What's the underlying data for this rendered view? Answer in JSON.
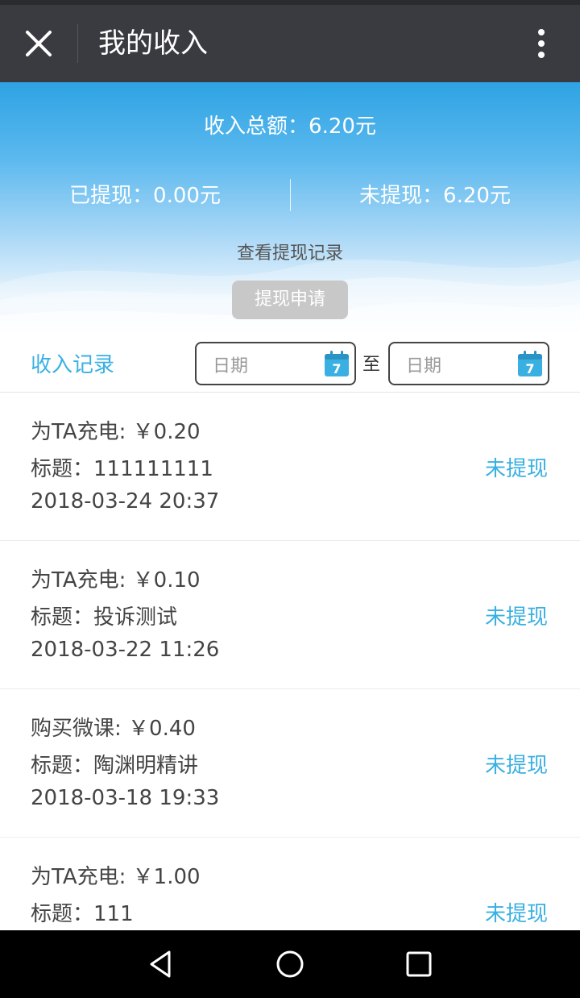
{
  "header": {
    "title": "我的收入"
  },
  "summary": {
    "total": "收入总额：6.20元",
    "withdrawn": "已提现：0.00元",
    "pending": "未提现：6.20元",
    "view_records": "查看提现记录",
    "apply_button": "提现申请"
  },
  "filter": {
    "label": "收入记录",
    "start_placeholder": "日期",
    "to_label": "至",
    "end_placeholder": "日期",
    "calendar_day": "7"
  },
  "records": [
    {
      "line1": "为TA充电: ￥0.20",
      "line2": "标题：111111111",
      "line3": "2018-03-24 20:37",
      "status": "未提现"
    },
    {
      "line1": "为TA充电: ￥0.10",
      "line2": "标题：投诉测试",
      "line3": "2018-03-22 11:26",
      "status": "未提现"
    },
    {
      "line1": "购买微课: ￥0.40",
      "line2": "标题：陶渊明精讲",
      "line3": "2018-03-18 19:33",
      "status": "未提现"
    },
    {
      "line1": "为TA充电: ￥1.00",
      "line2": "标题：111",
      "line3": "",
      "status": "未提现"
    }
  ],
  "colors": {
    "accent": "#3ab0e2",
    "topbar": "#393b40",
    "banner_top": "#2ea3e3"
  }
}
